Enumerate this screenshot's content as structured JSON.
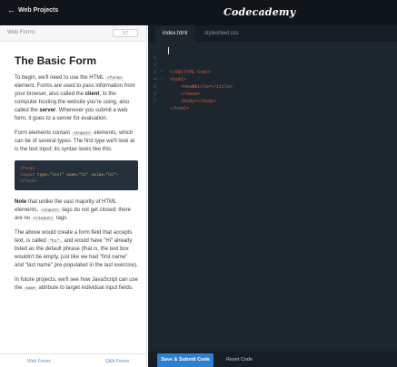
{
  "header": {
    "back_label": "Web Projects",
    "brand": "Codecademy"
  },
  "lesson": {
    "section_title": "Web Forms",
    "progress": "2/7",
    "title": "The Basic Form",
    "p1_a": "To begin, we'll need to use the HTML ",
    "p1_code": "<form>",
    "p1_b": " element. Forms are used to pass information from your browser, also called the ",
    "p1_client": "client",
    "p1_c": ", to the computer hosting the website you're using, also called the ",
    "p1_server": "server",
    "p1_d": ". Whenever you submit a web form, it goes to a server for evaluation.",
    "p2_a": "Form elements contain ",
    "p2_code": "<input>",
    "p2_b": " elements, which can be of several types. The first type we'll look at is the text input; its syntax looks like this:",
    "code_block": {
      "line1": "<form>",
      "line2_tag": "<input ",
      "line2_attr1": "type=",
      "line2_val1": "\"text\"",
      "line2_attr2": " name=",
      "line2_val2": "\"hi\"",
      "line2_attr3": " value=",
      "line2_val3": "\"Hi\"",
      "line2_end": ">",
      "line3": "</form>"
    },
    "p3_note": "Note",
    "p3_a": " that unlike the vast majority of HTML elements, ",
    "p3_code1": "<input>",
    "p3_b": " tags do not get closed; there are no ",
    "p3_code2": "</input>",
    "p3_c": " tags.",
    "p4_a": "The above would create a form field that accepts text, is called ",
    "p4_code": "\"hi\"",
    "p4_b": ", and would have \"Hi\" already listed as the default phrase (that is, the text box wouldn't be empty, just like we had \"first name\" and \"last name\" pre-populated in the last exercise).",
    "p5_a": "In future projects, we'll see how JavaScript can use the ",
    "p5_code": "name",
    "p5_b": " attribute to target individual input fields."
  },
  "footer_nav": {
    "prev": "Web Forms",
    "next": "Q&A Forum"
  },
  "editor": {
    "tabs": [
      {
        "label": "index.html"
      },
      {
        "label": "stylesheet.css"
      }
    ],
    "lines": [
      {
        "num": "1",
        "text": "<!DOCTYPE html>"
      },
      {
        "num": "2",
        "text": "<html>"
      },
      {
        "num": "3",
        "text": "<head>"
      },
      {
        "num": "4",
        "text": "<title></title>"
      },
      {
        "num": "5",
        "text": "</head>"
      },
      {
        "num": "6",
        "text": "<body></body>"
      },
      {
        "num": "7",
        "text": "</html>"
      }
    ],
    "submit_label": "Save & Submit Code",
    "reset_label": "Reset Code"
  },
  "colors": {
    "accent": "#2f7fd1",
    "topbar": "#10151a",
    "editor_bg": "#1d252d",
    "code_tag": "#d6613f"
  }
}
